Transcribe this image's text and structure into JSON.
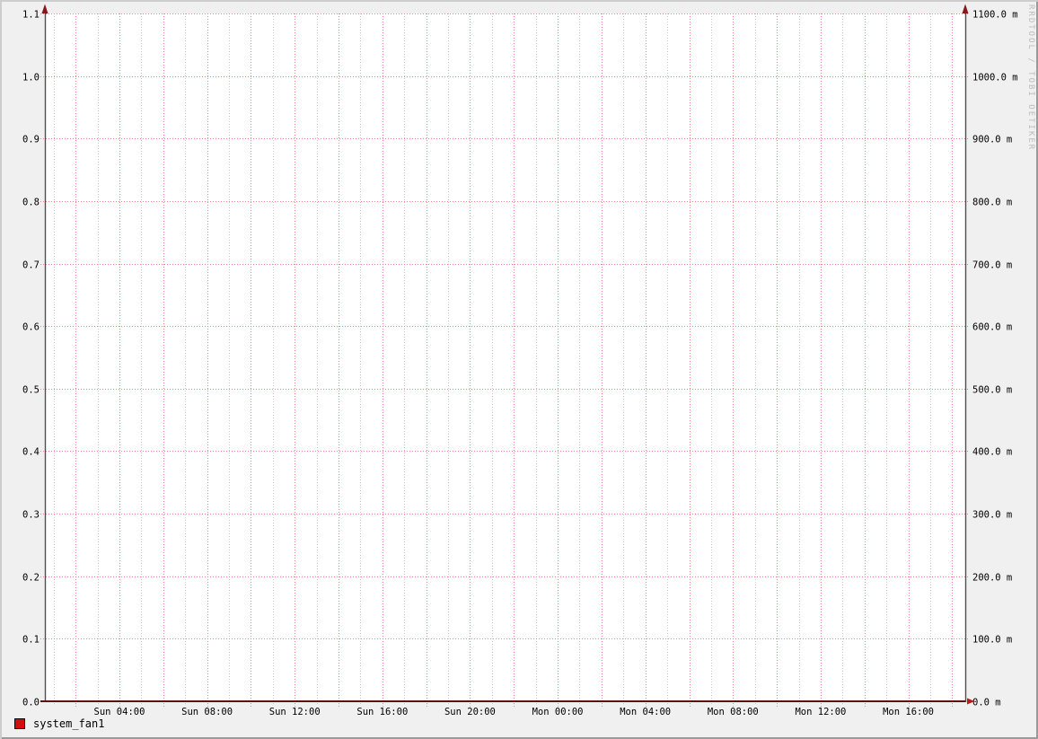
{
  "chart_data": {
    "type": "line",
    "title": "",
    "watermark": "RRDTOOL / TOBI OETIKER",
    "legend": [
      {
        "label": "system_fan1",
        "color": "#d01010",
        "border_color": "#000000"
      }
    ],
    "series": [
      {
        "name": "system_fan1",
        "color": "#5d1111",
        "constant_value": 0.0
      }
    ],
    "y_axis_left": {
      "min": 0.0,
      "max": 1.1,
      "tick_step": 0.1,
      "tick_labels": [
        "0.0",
        "0.1",
        "0.2",
        "0.3",
        "0.4",
        "0.5",
        "0.6",
        "0.7",
        "0.8",
        "0.9",
        "1.0",
        "1.1"
      ]
    },
    "y_axis_right": {
      "min": 0,
      "max": 1100,
      "tick_step": 100,
      "unit": "m",
      "tick_labels": [
        "0.0 m",
        "100.0 m",
        "200.0 m",
        "300.0 m",
        "400.0 m",
        "500.0 m",
        "600.0 m",
        "700.0 m",
        "800.0 m",
        "900.0 m",
        "1000.0 m",
        "1100.0 m"
      ]
    },
    "x_axis": {
      "total_hours": 42.0,
      "minor_grid_hours": 1,
      "major_grid_hours": 2,
      "first_gridline_offset_hours": 0.4,
      "tick_labels": [
        {
          "text": "Sun 04:00",
          "hour_offset": 3.4
        },
        {
          "text": "Sun 08:00",
          "hour_offset": 7.4
        },
        {
          "text": "Sun 12:00",
          "hour_offset": 11.4
        },
        {
          "text": "Sun 16:00",
          "hour_offset": 15.4
        },
        {
          "text": "Sun 20:00",
          "hour_offset": 19.4
        },
        {
          "text": "Mon 00:00",
          "hour_offset": 23.4
        },
        {
          "text": "Mon 04:00",
          "hour_offset": 27.4
        },
        {
          "text": "Mon 08:00",
          "hour_offset": 31.4
        },
        {
          "text": "Mon 12:00",
          "hour_offset": 35.4
        },
        {
          "text": "Mon 16:00",
          "hour_offset": 39.4
        }
      ]
    },
    "grid": {
      "on": true,
      "major_color": "#ee8585",
      "minor_color": "#c9c9c9"
    },
    "colors": {
      "page_bg": "#f0f0f0",
      "plot_bg": "#ffffff",
      "axis": "#4f4f4f",
      "x_axis_line": "#5d1111",
      "up_arrow": "#8a1717",
      "right_arrow": "#b71d1d",
      "watermark_text": "#bcbcbc"
    }
  }
}
